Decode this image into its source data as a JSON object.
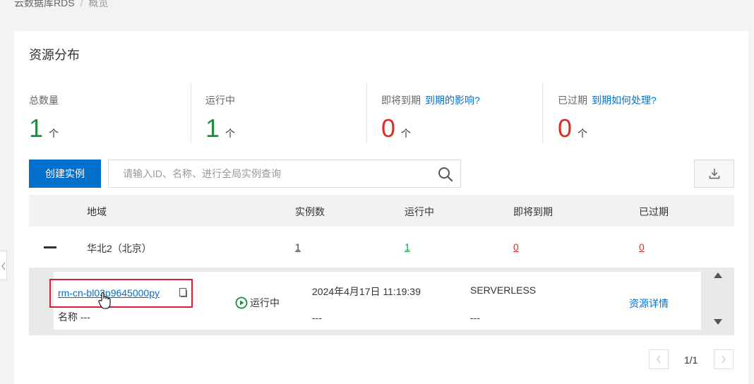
{
  "breadcrumb": {
    "root": "云数据库RDS",
    "current": "概览"
  },
  "card": {
    "title": "资源分布"
  },
  "stats": {
    "total": {
      "label": "总数量",
      "value": "1",
      "unit": "个"
    },
    "running": {
      "label": "运行中",
      "value": "1",
      "unit": "个"
    },
    "expiring": {
      "label": "即将到期",
      "link": "到期的影响?",
      "value": "0",
      "unit": "个"
    },
    "expired": {
      "label": "已过期",
      "link": "到期如何处理?",
      "value": "0",
      "unit": "个"
    }
  },
  "toolbar": {
    "create_label": "创建实例",
    "search_placeholder": "请输入ID、名称、进行全局实例查询"
  },
  "table": {
    "headers": [
      "地域",
      "实例数",
      "运行中",
      "即将到期",
      "已过期"
    ],
    "region_row": {
      "region": "华北2（北京）",
      "instances": "1",
      "running": "1",
      "expiring": "0",
      "expired": "0"
    }
  },
  "instance": {
    "id": "rm-cn-bl03p9645000py",
    "name_label": "名称",
    "name_value": "---",
    "status": "运行中",
    "created": "2024年4月17日 11:19:39",
    "created_sub": "---",
    "type": "SERVERLESS",
    "type_sub": "---",
    "detail_link": "资源详情"
  },
  "pagination": {
    "text": "1/1"
  },
  "colors": {
    "accent": "#0070cc",
    "running": "#1e8e3e",
    "expired": "#d93026"
  }
}
